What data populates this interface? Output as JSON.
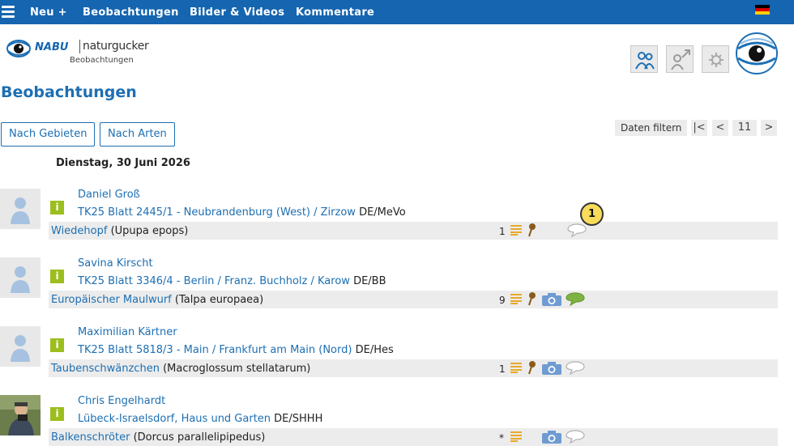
{
  "nav": {
    "items": [
      "Neu +",
      "Bilder & Videos",
      "Beobachtungen",
      "Kommentare"
    ],
    "new_label": "Neu +",
    "observations_label": "Beobachtungen",
    "media_label": "Bilder & Videos",
    "comments_label": "Kommentare",
    "language_flag": "german-flag-icon"
  },
  "logo": {
    "brand": "NABU",
    "product": "naturgucker",
    "subtitle": "Beobachtungen"
  },
  "page_title": "Beobachtungen",
  "buttons": {
    "by_areas": "Nach Gebieten",
    "by_species": "Nach Arten",
    "filter": "Daten filtern"
  },
  "pager": {
    "first": "|<",
    "prev": "<",
    "page": "11",
    "next": ">"
  },
  "date_heading": "Dienstag, 30 Juni 2026",
  "entries": [
    {
      "user": "Daniel Groß",
      "location_link": "TK25 Blatt 2445/1 - Neubrandenburg (West) / Zirzow",
      "region": "DE/MeVo",
      "species_common": "Wiedehopf",
      "species_latin": "(Upupa epops)",
      "count": "1",
      "has_photo": false,
      "comment_active": false
    },
    {
      "user": "Savina Kirscht",
      "location_link": "TK25 Blatt 3346/4 - Berlin / Franz. Buchholz / Karow",
      "region": "DE/BB",
      "species_common": "Europäischer Maulwurf",
      "species_latin": "(Talpa europaea)",
      "count": "9",
      "has_photo": true,
      "comment_active": true
    },
    {
      "user": "Maximilian Kärtner",
      "location_link": "TK25 Blatt 5818/3 - Main / Frankfurt am Main (Nord)",
      "region": "DE/Hes",
      "species_common": "Taubenschwänzchen",
      "species_latin": "(Macroglossum stellatarum)",
      "count": "1",
      "has_photo": true,
      "comment_active": false
    },
    {
      "user": "Chris Engelhardt",
      "location_link": "Lübeck-Israelsdorf, Haus und Garten",
      "region": "DE/SHHH",
      "species_common": "Balkenschröter",
      "species_latin": "(Dorcus parallelipipedus)",
      "count": "*",
      "has_photo": true,
      "comment_active": false
    }
  ],
  "info_badge": "i",
  "marker": "1",
  "colors": {
    "nav": "#1565b0",
    "link": "#1d6fb3",
    "badge": "#9cbe1e",
    "marker": "#f8dc5a"
  }
}
